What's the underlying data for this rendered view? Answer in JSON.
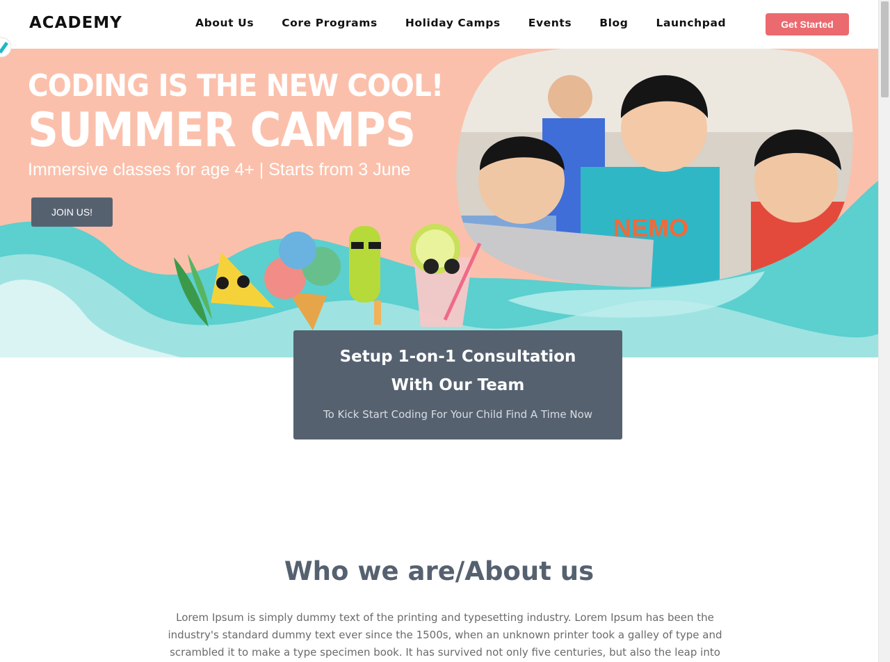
{
  "header": {
    "logo": "ACADEMY",
    "nav": [
      "About Us",
      "Core Programs",
      "Holiday Camps",
      "Events",
      "Blog",
      "Launchpad"
    ],
    "cta": "Get Started"
  },
  "hero": {
    "headline": "CODING IS THE NEW COOL!",
    "title": "SUMMER CAMPS",
    "subtitle": "Immersive classes for age 4+ | Starts from 3 June",
    "button": "JOIN US!"
  },
  "consultation": {
    "line1": "Setup 1-on-1 Consultation",
    "line2": "With Our Team",
    "subtitle": "To Kick Start Coding For Your Child Find A Time Now"
  },
  "about": {
    "title": "Who we are/About us",
    "text": "Lorem Ipsum is simply dummy text of the printing and typesetting industry. Lorem Ipsum has been the industry's standard dummy text ever since the 1500s, when an unknown printer took a galley of type and scrambled it to make a type specimen book. It has survived not only five centuries, but also the leap into electronic typesetting,"
  },
  "colors": {
    "accent": "#ea6a6f",
    "slate": "#566170",
    "hero_bg": "#fbc0ab",
    "wave": "#5ccfcf"
  }
}
